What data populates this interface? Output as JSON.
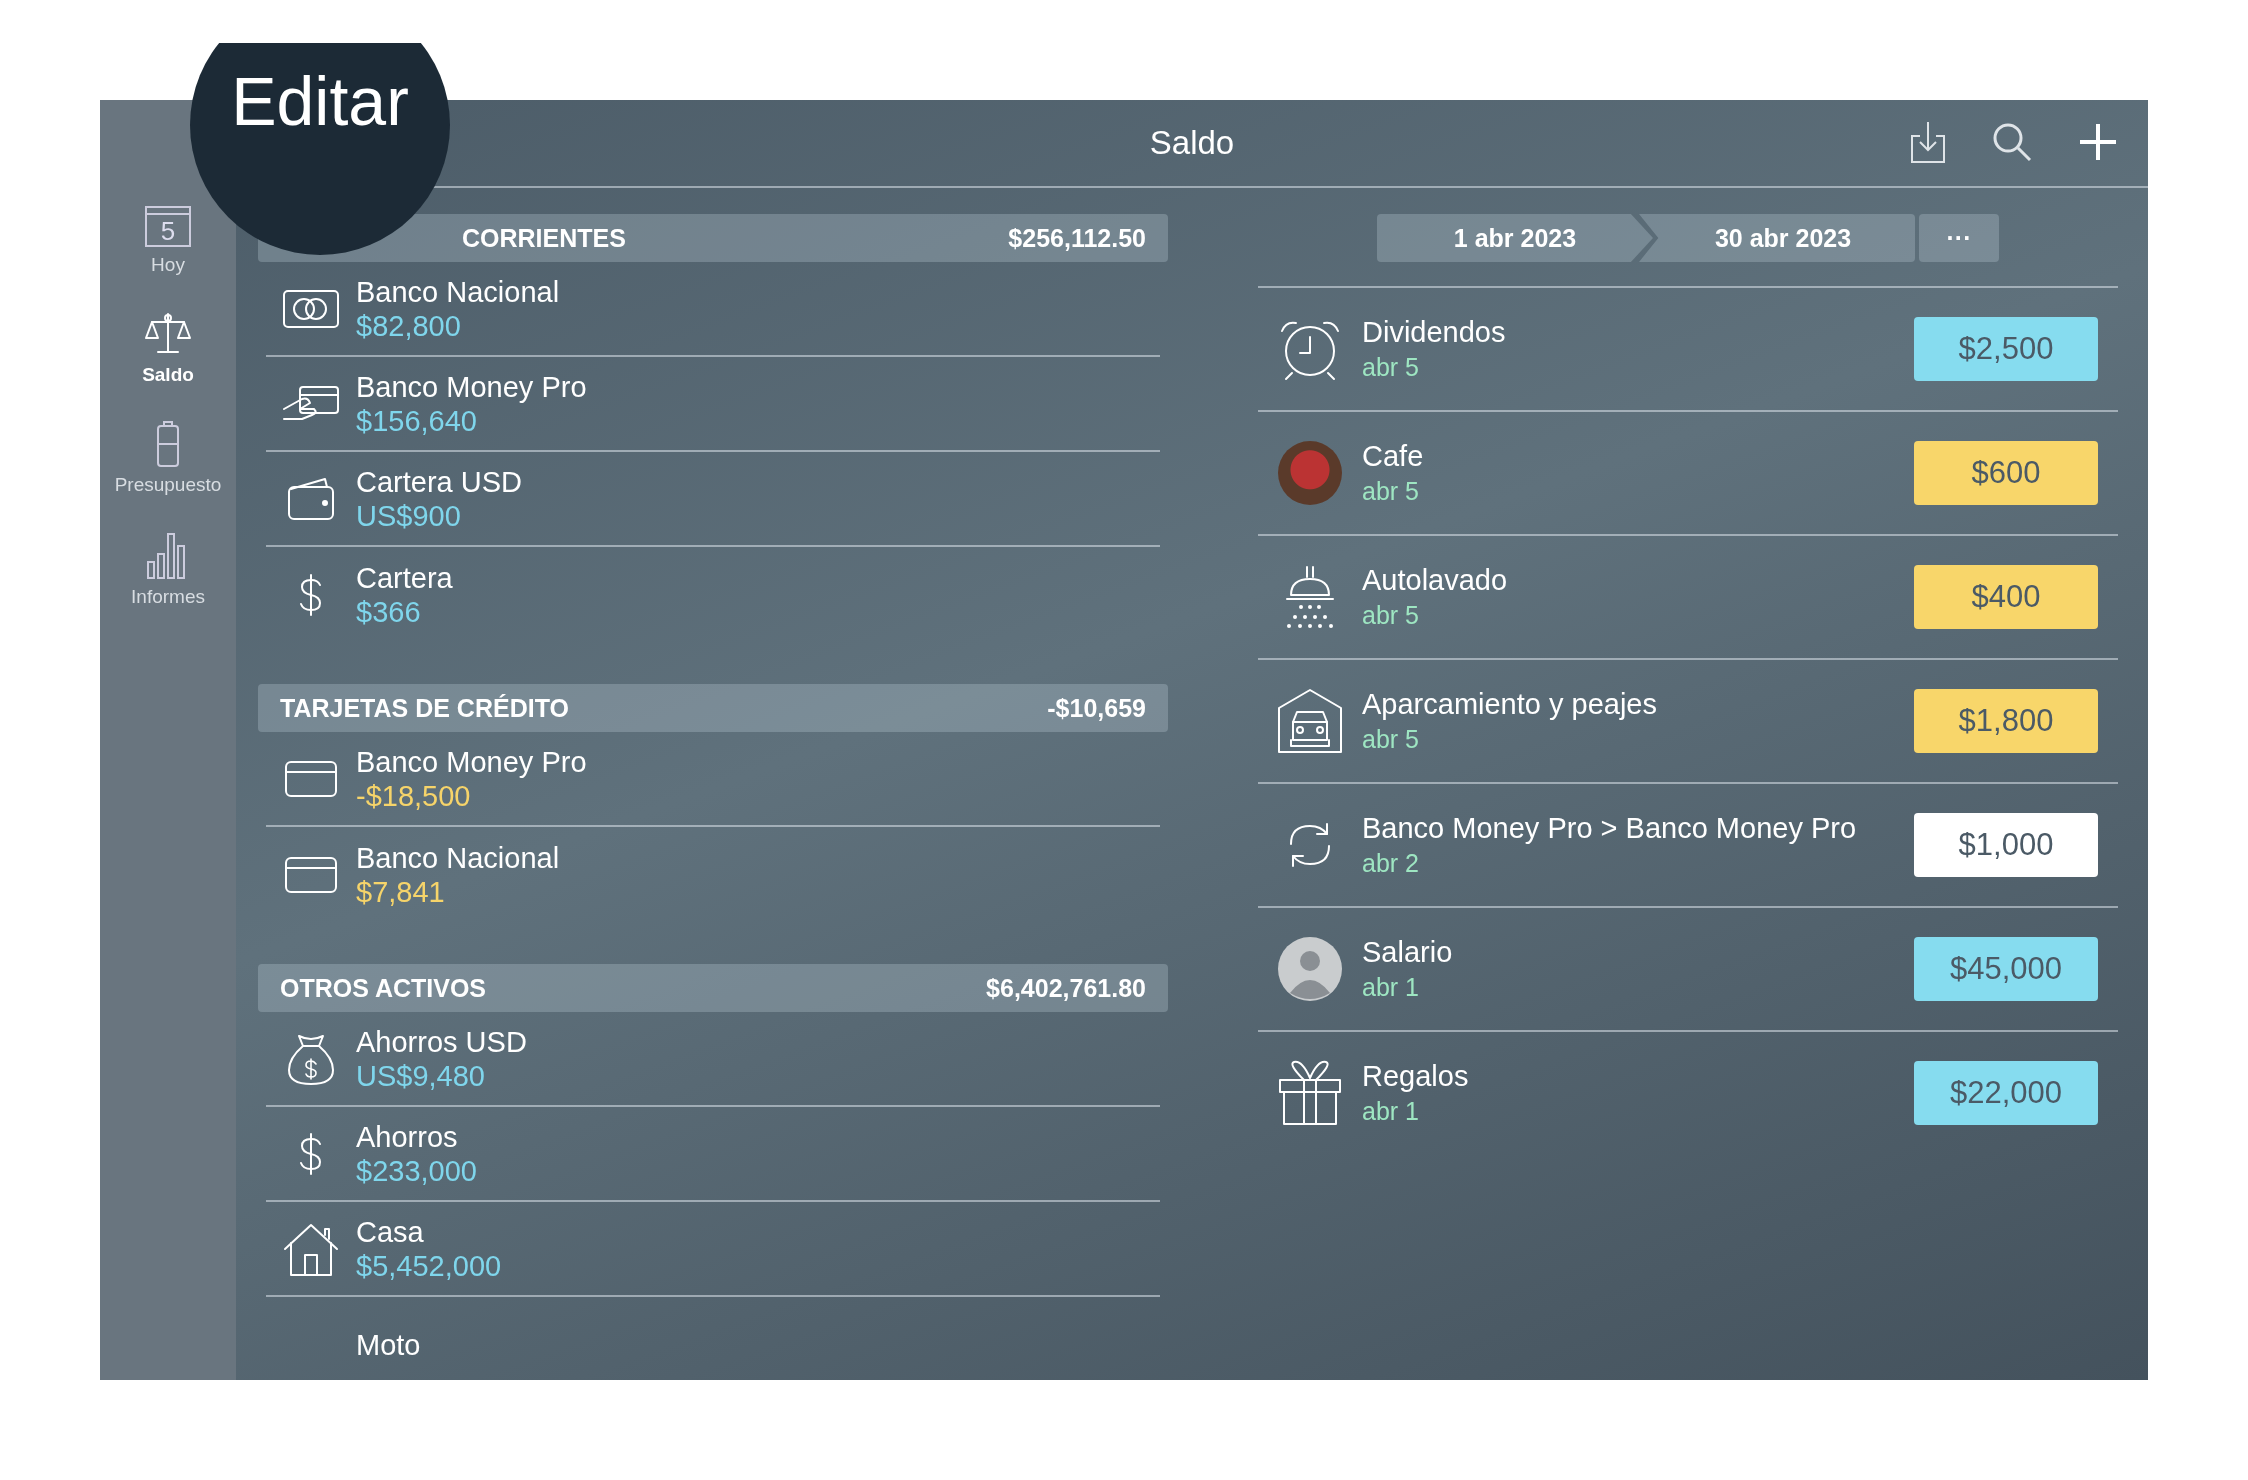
{
  "editar_label": "Editar",
  "header": {
    "title": "Saldo"
  },
  "sidebar": {
    "items": [
      {
        "label": "Hoy",
        "kind": "calendar",
        "icon_text": "5",
        "selected": false
      },
      {
        "label": "Saldo",
        "kind": "scale",
        "selected": true
      },
      {
        "label": "Presupuesto",
        "kind": "jar",
        "selected": false
      },
      {
        "label": "Informes",
        "kind": "bars",
        "selected": false
      }
    ]
  },
  "sections": [
    {
      "title": "CORRIENTES",
      "total": "$256,112.50",
      "accounts": [
        {
          "name": "Banco Nacional",
          "amount": "$82,800",
          "color": "#7fd6ec",
          "kind": "card-reader"
        },
        {
          "name": "Banco Money Pro",
          "amount": "$156,640",
          "color": "#7fd6ec",
          "kind": "hand-card"
        },
        {
          "name": "Cartera USD",
          "amount": "US$900",
          "color": "#7fd6ec",
          "kind": "wallet"
        },
        {
          "name": "Cartera",
          "amount": "$366",
          "color": "#7fd6ec",
          "kind": "dollar"
        }
      ]
    },
    {
      "title": "TARJETAS DE CRÉDITO",
      "total": "-$10,659",
      "accounts": [
        {
          "name": "Banco Money Pro",
          "amount": "-$18,500",
          "color": "#f6d46a",
          "kind": "card"
        },
        {
          "name": "Banco Nacional",
          "amount": "$7,841",
          "color": "#f6d46a",
          "kind": "card"
        }
      ]
    },
    {
      "title": "OTROS ACTIVOS",
      "total": "$6,402,761.80",
      "accounts": [
        {
          "name": "Ahorros USD",
          "amount": "US$9,480",
          "color": "#7fd6ec",
          "kind": "moneybag"
        },
        {
          "name": "Ahorros",
          "amount": "$233,000",
          "color": "#7fd6ec",
          "kind": "dollar"
        },
        {
          "name": "Casa",
          "amount": "$5,452,000",
          "color": "#7fd6ec",
          "kind": "house"
        },
        {
          "name": "Moto"
        }
      ]
    }
  ],
  "period": {
    "start": "1 abr 2023",
    "end": "30 abr 2023",
    "more": "···"
  },
  "transactions": [
    {
      "title": "Dividendos",
      "date": "abr 5",
      "amount": "$2,500",
      "color": "#86dcef",
      "kind": "alarm"
    },
    {
      "title": "Cafe",
      "date": "abr 5",
      "amount": "$600",
      "color": "#f8d66a",
      "kind": "photo"
    },
    {
      "title": "Autolavado",
      "date": "abr 5",
      "amount": "$400",
      "color": "#f8d66a",
      "kind": "shower"
    },
    {
      "title": "Aparcamiento y peajes",
      "date": "abr 5",
      "amount": "$1,800",
      "color": "#f8d66a",
      "kind": "garage"
    },
    {
      "title": "Banco Money Pro > Banco Money Pro",
      "date": "abr 2",
      "amount": "$1,000",
      "color": "#ffffff",
      "kind": "sync"
    },
    {
      "title": "Salario",
      "date": "abr 1",
      "amount": "$45,000",
      "color": "#86dcef",
      "kind": "avatar"
    },
    {
      "title": "Regalos",
      "date": "abr 1",
      "amount": "$22,000",
      "color": "#86dcef",
      "kind": "gift"
    }
  ]
}
